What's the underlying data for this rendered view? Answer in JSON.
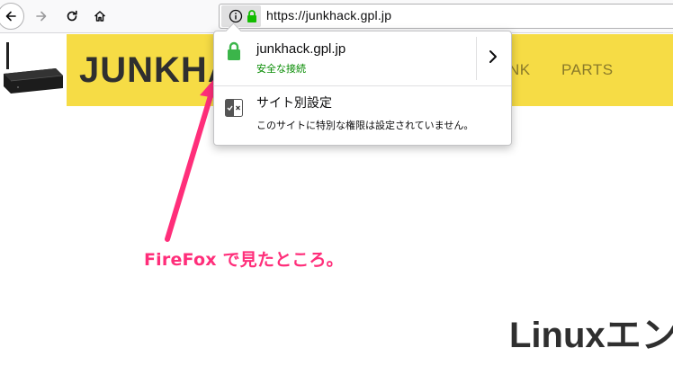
{
  "browser": {
    "url": "https://junkhack.gpl.jp",
    "icons": [
      "back-icon",
      "forward-icon",
      "reload-icon",
      "home-icon",
      "info-icon",
      "lock-icon"
    ]
  },
  "site": {
    "title": "JUNKHACK",
    "nav_links": [
      "NK",
      "PARTS"
    ],
    "headline": "Linuxエン",
    "accent_color": "#f6dc45"
  },
  "popup": {
    "domain": "junkhack.gpl.jp",
    "secure_label": "安全な接続",
    "permissions_title": "サイト別設定",
    "permissions_desc": "このサイトに特別な権限は設定されていません。",
    "secure_color": "#3bb54a"
  },
  "annotation": {
    "text": "FireFox で見たところ。",
    "color": "#ff2e7a"
  }
}
